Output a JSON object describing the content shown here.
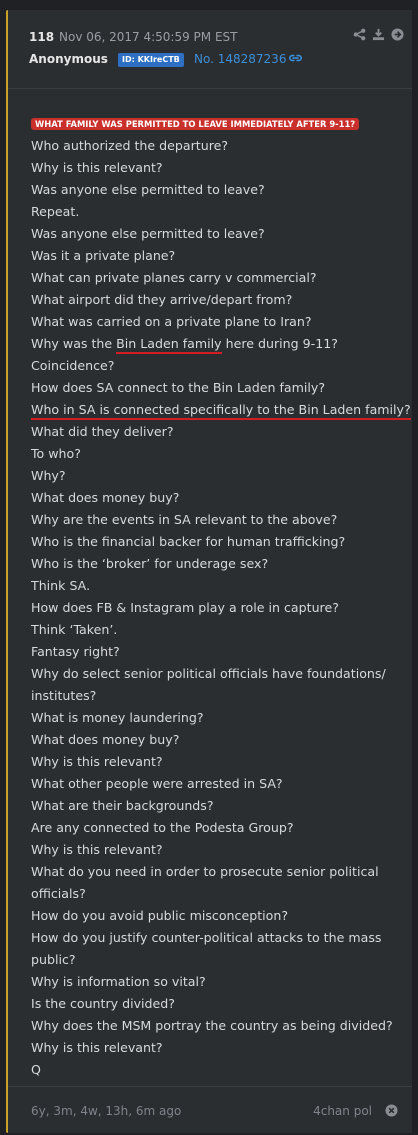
{
  "post": {
    "number": "118",
    "date": "Nov 06, 2017 4:50:59 PM EST",
    "author": "Anonymous",
    "id_badge": "ID: KKIreCTB",
    "post_no": "No. 148287236",
    "title": "WHAT FAMILY WAS PERMITTED TO LEAVE IMMEDIATELY AFTER 9-11?",
    "lines": [
      "Who authorized the departure?",
      "Why is this relevant?",
      "Was anyone else permitted to leave?",
      "Repeat.",
      "Was anyone else permitted to leave?",
      "Was it a private plane?",
      "What can private planes carry v commercial?",
      "What airport did they arrive/depart from?",
      "What was carried on a private plane to Iran?",
      "__SPLIT__",
      "Coincidence?",
      "How does SA connect to the Bin Laden family?",
      "__UL__",
      "What did they deliver?",
      "To who?",
      "Why?",
      "What does money buy?",
      "Why are the events in SA relevant to the above?",
      "Who is the financial backer for human trafficking?",
      "Who is the ‘broker’ for underage sex?",
      "Think SA.",
      "How does FB & Instagram play a role in capture?",
      "Think ‘Taken’.",
      "Fantasy right?",
      "Why do select senior political officials have foundations/",
      "institutes?",
      "What is money laundering?",
      "What does money buy?",
      "Why is this relevant?",
      "What other people were arrested in SA?",
      "What are their backgrounds?",
      "Are any connected to the Podesta Group?",
      "Why is this relevant?",
      "What do you need in order to prosecute senior political",
      "officials?",
      "How do you avoid public misconception?",
      "How do you justify counter-political attacks to the mass",
      "public?",
      "Why is information so vital?",
      "Is the country divided?",
      "Why does the MSM portray the country as being divided?",
      "Why is this relevant?",
      "Q"
    ],
    "split_line": {
      "before": "Why was the ",
      "underlined": "Bin Laden family",
      "after": " here during 9-11?"
    },
    "underlined_line": "Who in SA is connected specifically to the Bin Laden family?",
    "age": "6y, 3m, 4w, 13h, 6m ago",
    "source": "4chan pol"
  },
  "icons": [
    "share-icon",
    "download-icon",
    "arrow-right-circle-icon",
    "link-icon",
    "close-circle-icon"
  ],
  "colors": {
    "page_bg": "#1f2124",
    "card_bg": "#2b2e31",
    "accent_border": "#c8a02a",
    "title_bg": "#c9302c",
    "underline": "#d01e24",
    "id_badge_bg": "#2d6fc3",
    "link": "#3b8fd9"
  }
}
